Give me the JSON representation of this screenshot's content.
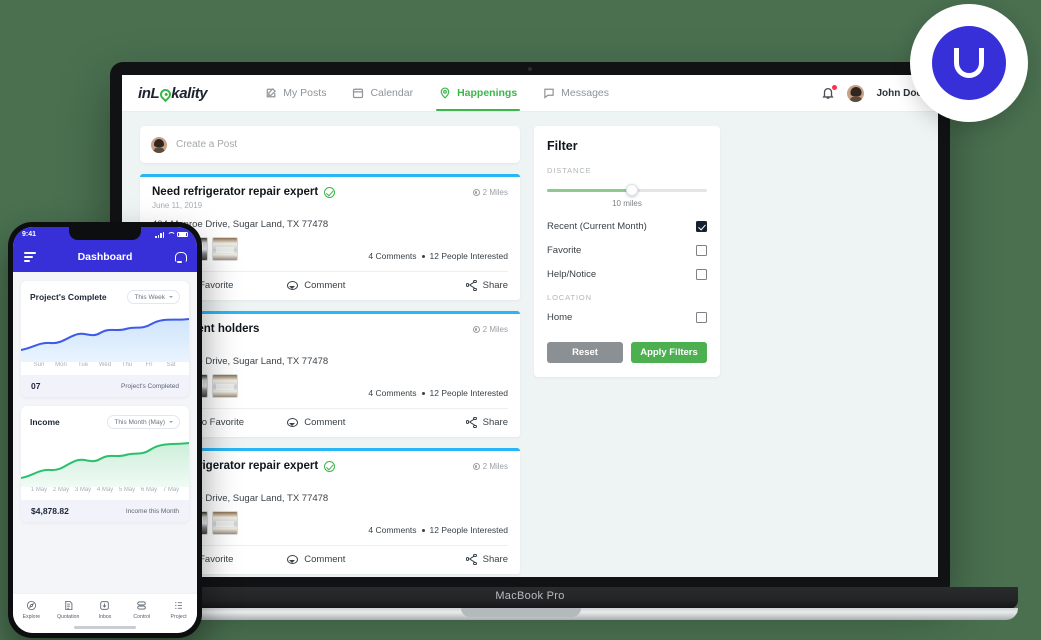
{
  "background_color": "#4a7050",
  "accent": {
    "green": "#3cb54a",
    "blue_card": "#29b6f6",
    "apply_green": "#4caf50",
    "phone_blue": "#3730d8",
    "heart_red": "#f4235a"
  },
  "badge": {
    "letter": "U"
  },
  "laptop": {
    "model_label": "MacBook Pro"
  },
  "app": {
    "logo": {
      "before": "inL",
      "after": "kality"
    },
    "nav": [
      {
        "label": "My Posts",
        "icon": "pencil-square-icon",
        "active": false
      },
      {
        "label": "Calendar",
        "icon": "calendar-icon",
        "active": false
      },
      {
        "label": "Happenings",
        "icon": "location-pin-icon",
        "active": true
      },
      {
        "label": "Messages",
        "icon": "chat-bubble-icon",
        "active": false
      }
    ],
    "user": {
      "name": "John Doe",
      "notification_icon": "bell-icon",
      "has_notification": true
    },
    "create_post": {
      "placeholder": "Create a Post"
    },
    "posts": [
      {
        "title": "Need refrigerator repair expert",
        "verified": true,
        "distance": "2 Miles",
        "date": "June 11, 2019",
        "address": "404 Monroe Drive, Sugar Land, TX 77478",
        "comments": "4 Comments",
        "interested": "12 People Interested",
        "favorite_label": "Add to Favorite",
        "favorited": false,
        "comment_label": "Comment",
        "share_label": "Share"
      },
      {
        "title": "Need Event holders",
        "verified": false,
        "distance": "2 Miles",
        "date": "June 11, 2019",
        "address": "404 Monroe Drive, Sugar Land, TX 77478",
        "comments": "4 Comments",
        "interested": "12 People Interested",
        "favorite_label": "Added to Favorite",
        "favorited": true,
        "comment_label": "Comment",
        "share_label": "Share"
      },
      {
        "title": "Need refrigerator repair expert",
        "verified": true,
        "distance": "2 Miles",
        "date": "June 11, 2019",
        "address": "404 Monroe Drive, Sugar Land, TX 77478",
        "comments": "4 Comments",
        "interested": "12 People Interested",
        "favorite_label": "Add to Favorite",
        "favorited": false,
        "comment_label": "Comment",
        "share_label": "Share"
      }
    ],
    "filter": {
      "title": "Filter",
      "distance_label": "DISTANCE",
      "distance_value": "10 miles",
      "slider_percent": 53,
      "options": [
        {
          "label": "Recent (Current Month)",
          "checked": true
        },
        {
          "label": "Favorite",
          "checked": false
        },
        {
          "label": "Help/Notice",
          "checked": false
        }
      ],
      "location_label": "LOCATION",
      "location_options": [
        {
          "label": "Home",
          "checked": false
        }
      ],
      "reset_label": "Reset",
      "apply_label": "Apply Filters"
    }
  },
  "phone": {
    "status": {
      "time": "9:41"
    },
    "header": {
      "title": "Dashboard",
      "menu_icon": "hamburger-icon",
      "bell_icon": "bell-icon"
    },
    "cards": [
      {
        "title": "Project's Complete",
        "selector": "This Week",
        "days": [
          "Sun",
          "Mon",
          "Tue",
          "Wed",
          "Thu",
          "Fri",
          "Sat"
        ],
        "footer_value": "07",
        "footer_label": "Project's Completed"
      },
      {
        "title": "Income",
        "selector": "This Month (May)",
        "days": [
          "1 May",
          "2 May",
          "3 May",
          "4 May",
          "5 May",
          "6 May",
          "7 May"
        ],
        "footer_value": "$4,878.82",
        "footer_label": "Income this Month"
      }
    ],
    "tabs": [
      {
        "label": "Explore",
        "icon": "compass-icon"
      },
      {
        "label": "Quotation",
        "icon": "document-icon"
      },
      {
        "label": "Inbox",
        "icon": "inbox-download-icon"
      },
      {
        "label": "Control",
        "icon": "server-icon"
      },
      {
        "label": "Project",
        "icon": "list-icon"
      }
    ]
  },
  "chart_data": [
    {
      "type": "area",
      "title": "Project's Complete",
      "categories": [
        "Sun",
        "Mon",
        "Tue",
        "Wed",
        "Thu",
        "Fri",
        "Sat"
      ],
      "values": [
        18,
        26,
        24,
        40,
        34,
        52,
        58
      ],
      "color": "#3d5ae8",
      "xlabel": "",
      "ylabel": "",
      "grid": false,
      "legend": "none"
    },
    {
      "type": "area",
      "title": "Income",
      "categories": [
        "1 May",
        "2 May",
        "3 May",
        "4 May",
        "5 May",
        "6 May",
        "7 May"
      ],
      "values": [
        14,
        24,
        22,
        36,
        33,
        50,
        57
      ],
      "color": "#2bc06b",
      "xlabel": "",
      "ylabel": "",
      "grid": false,
      "legend": "none"
    }
  ]
}
